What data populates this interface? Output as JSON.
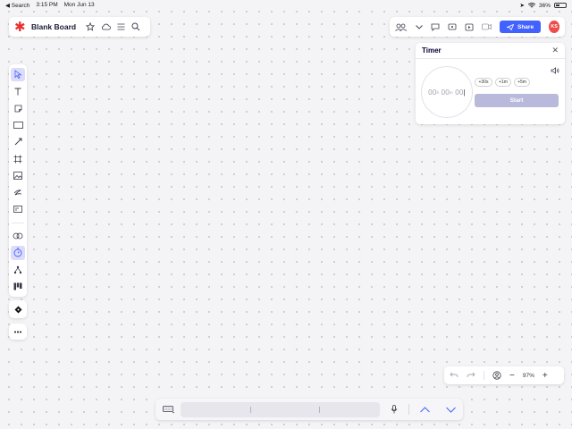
{
  "status_bar": {
    "back_app": "◀ Search",
    "time": "3:15 PM",
    "date": "Mon Jun 13",
    "battery": "36%"
  },
  "header": {
    "board_title": "Blank Board",
    "share_label": "Share",
    "avatar_initials": "KS"
  },
  "timer": {
    "title": "Timer",
    "hours": "00",
    "hours_unit": "h",
    "minutes": "00",
    "minutes_unit": "m",
    "seconds": "00",
    "increments": [
      "+30s",
      "+1m",
      "+5m"
    ],
    "start_label": "Start"
  },
  "zoom": {
    "level": "97%",
    "minus": "−",
    "plus": "+"
  },
  "colors": {
    "accent": "#4262ff",
    "logo": "#e8322f",
    "avatar": "#f04a4a",
    "start_disabled": "#b9b9dc"
  }
}
